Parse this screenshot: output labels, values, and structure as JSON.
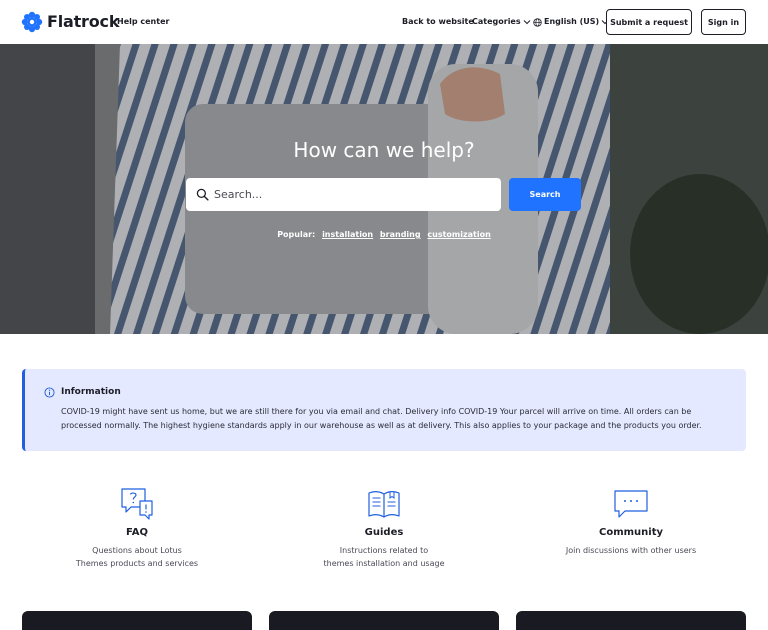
{
  "header": {
    "logo_text": "Flatrock",
    "help_center": "Help center",
    "nav": {
      "back_to_website": "Back to website",
      "categories": "Categories",
      "language": "English (US)"
    },
    "submit_request": "Submit a request",
    "sign_in": "Sign in"
  },
  "hero": {
    "title": "How can we help?",
    "search_placeholder": "Search...",
    "search_button": "Search",
    "popular_label": "Popular:",
    "popular_links": [
      "installation",
      "branding",
      "customization"
    ]
  },
  "notice": {
    "title": "Information",
    "text": "COVID-19 might have sent us home, but we are still there for you via email and chat. Delivery info COVID-19 Your parcel will arrive on time. All orders can be processed normally. The highest hygiene standards apply in our warehouse as well as at delivery. This also applies to your package and the products you order."
  },
  "categories": [
    {
      "title": "FAQ",
      "desc_line1": "Questions about Lotus",
      "desc_line2": "Themes products and services",
      "icon": "question-chat-icon"
    },
    {
      "title": "Guides",
      "desc_line1": "Instructions related to",
      "desc_line2": "themes installation and usage",
      "icon": "book-icon"
    },
    {
      "title": "Community",
      "desc_line1": "Join discussions with other users",
      "desc_line2": "",
      "icon": "chat-bubble-icon"
    }
  ],
  "colors": {
    "accent": "#1f73ff",
    "notice_bg": "#e4e9ff",
    "notice_border": "#1f5fe0",
    "text": "#1d1d27",
    "card_dark": "#1a1a22"
  }
}
